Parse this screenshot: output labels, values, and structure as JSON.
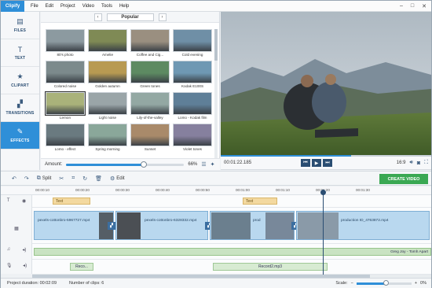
{
  "app": {
    "logo": "Clipify"
  },
  "menu": [
    "File",
    "Edit",
    "Project",
    "Video",
    "Tools",
    "Help"
  ],
  "window_controls": [
    "–",
    "□",
    "✕"
  ],
  "sidebar": {
    "items": [
      {
        "label": "FILES",
        "icon": "folder-icon",
        "glyph": "▤",
        "active": false
      },
      {
        "label": "TEXT",
        "icon": "text-icon",
        "glyph": "T",
        "active": false
      },
      {
        "label": "CLIPART",
        "icon": "star-icon",
        "glyph": "★",
        "active": false
      },
      {
        "label": "TRANSITIONS",
        "icon": "transitions-icon",
        "glyph": "▞",
        "active": false
      },
      {
        "label": "EFFECTS",
        "icon": "effects-icon",
        "glyph": "✎",
        "active": true
      }
    ]
  },
  "effects_panel": {
    "category": "Popular",
    "thumbnails": [
      {
        "label": "80's photo",
        "tint": "#8c9aa0"
      },
      {
        "label": "Amelie",
        "tint": "#7f8a55"
      },
      {
        "label": "Coffee and Cig...",
        "tint": "#9a8f80"
      },
      {
        "label": "Cold evening",
        "tint": "#6f8fa6"
      },
      {
        "label": "Colored noise",
        "tint": "#7c8a8c"
      },
      {
        "label": "Golden autumn",
        "tint": "#b89a52"
      },
      {
        "label": "Green tones",
        "tint": "#5d8a62"
      },
      {
        "label": "Kodak E100S",
        "tint": "#6f98b3"
      },
      {
        "label": "Lemon",
        "tint": "#a9b27a"
      },
      {
        "label": "Light noise",
        "tint": "#9aa5a8"
      },
      {
        "label": "Lily-of-the-valley",
        "tint": "#93a8a3"
      },
      {
        "label": "Lomo - Kodak film",
        "tint": "#5f7f98"
      },
      {
        "label": "Lomo - effect",
        "tint": "#6a7a80"
      },
      {
        "label": "Spring morning",
        "tint": "#8aa79a"
      },
      {
        "label": "Sunset",
        "tint": "#a98a6a"
      },
      {
        "label": "Violet tones",
        "tint": "#86809e"
      }
    ],
    "selected_index": 8,
    "amount_label": "Amount:",
    "amount_value": "66%",
    "amount_fraction": 0.66
  },
  "preview": {
    "timecode": "00:01:22.185",
    "aspect": "16:9",
    "progress_fraction": 0.62
  },
  "toolbar": {
    "split": "Split",
    "edit": "Edit",
    "create_video": "CREATE VIDEO"
  },
  "ruler_ticks": [
    "00:00:10",
    "00:00:20",
    "00:00:30",
    "00:00:40",
    "00:00:50",
    "00:01:00",
    "00:01:10",
    "00:01:20",
    "00:01:30"
  ],
  "timeline": {
    "text_clips": [
      "Text",
      "Text"
    ],
    "video_clips": [
      "pexels-cottonbro-5967727.mp4",
      "pexels-cottonbro-6328332.mp4",
      "prod",
      "production ID_4763872.mp4"
    ],
    "music_clip": "Greg Joy - Tomh Apart",
    "voice_clips": [
      "Reco...",
      "Record2.mp3"
    ]
  },
  "status": {
    "duration_label": "Project duration:",
    "duration_value": "00:02:09",
    "clips_label": "Number of clips:",
    "clips_value": "6",
    "scale_label": "Scale:",
    "scale_value": "0%",
    "scale_fraction": 0.55
  },
  "colors": {
    "accent": "#2f8fd8",
    "create": "#3aa853",
    "nav": "#2a4d72"
  }
}
